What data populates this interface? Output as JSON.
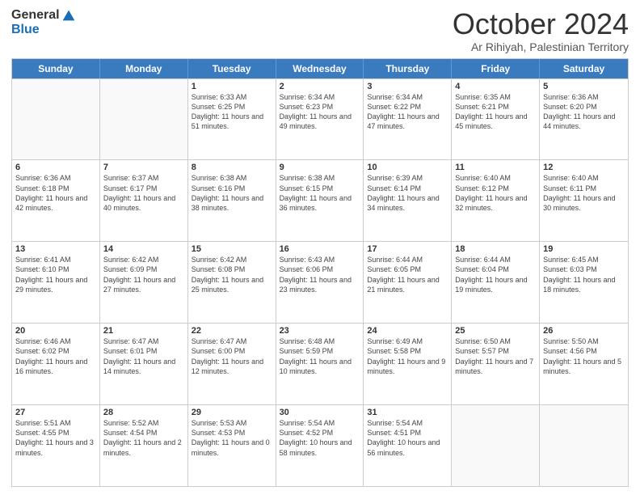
{
  "logo": {
    "general": "General",
    "blue": "Blue"
  },
  "title": "October 2024",
  "subtitle": "Ar Rihiyah, Palestinian Territory",
  "header_days": [
    "Sunday",
    "Monday",
    "Tuesday",
    "Wednesday",
    "Thursday",
    "Friday",
    "Saturday"
  ],
  "rows": [
    [
      {
        "day": "",
        "info": ""
      },
      {
        "day": "",
        "info": ""
      },
      {
        "day": "1",
        "info": "Sunrise: 6:33 AM\nSunset: 6:25 PM\nDaylight: 11 hours and 51 minutes."
      },
      {
        "day": "2",
        "info": "Sunrise: 6:34 AM\nSunset: 6:23 PM\nDaylight: 11 hours and 49 minutes."
      },
      {
        "day": "3",
        "info": "Sunrise: 6:34 AM\nSunset: 6:22 PM\nDaylight: 11 hours and 47 minutes."
      },
      {
        "day": "4",
        "info": "Sunrise: 6:35 AM\nSunset: 6:21 PM\nDaylight: 11 hours and 45 minutes."
      },
      {
        "day": "5",
        "info": "Sunrise: 6:36 AM\nSunset: 6:20 PM\nDaylight: 11 hours and 44 minutes."
      }
    ],
    [
      {
        "day": "6",
        "info": "Sunrise: 6:36 AM\nSunset: 6:18 PM\nDaylight: 11 hours and 42 minutes."
      },
      {
        "day": "7",
        "info": "Sunrise: 6:37 AM\nSunset: 6:17 PM\nDaylight: 11 hours and 40 minutes."
      },
      {
        "day": "8",
        "info": "Sunrise: 6:38 AM\nSunset: 6:16 PM\nDaylight: 11 hours and 38 minutes."
      },
      {
        "day": "9",
        "info": "Sunrise: 6:38 AM\nSunset: 6:15 PM\nDaylight: 11 hours and 36 minutes."
      },
      {
        "day": "10",
        "info": "Sunrise: 6:39 AM\nSunset: 6:14 PM\nDaylight: 11 hours and 34 minutes."
      },
      {
        "day": "11",
        "info": "Sunrise: 6:40 AM\nSunset: 6:12 PM\nDaylight: 11 hours and 32 minutes."
      },
      {
        "day": "12",
        "info": "Sunrise: 6:40 AM\nSunset: 6:11 PM\nDaylight: 11 hours and 30 minutes."
      }
    ],
    [
      {
        "day": "13",
        "info": "Sunrise: 6:41 AM\nSunset: 6:10 PM\nDaylight: 11 hours and 29 minutes."
      },
      {
        "day": "14",
        "info": "Sunrise: 6:42 AM\nSunset: 6:09 PM\nDaylight: 11 hours and 27 minutes."
      },
      {
        "day": "15",
        "info": "Sunrise: 6:42 AM\nSunset: 6:08 PM\nDaylight: 11 hours and 25 minutes."
      },
      {
        "day": "16",
        "info": "Sunrise: 6:43 AM\nSunset: 6:06 PM\nDaylight: 11 hours and 23 minutes."
      },
      {
        "day": "17",
        "info": "Sunrise: 6:44 AM\nSunset: 6:05 PM\nDaylight: 11 hours and 21 minutes."
      },
      {
        "day": "18",
        "info": "Sunrise: 6:44 AM\nSunset: 6:04 PM\nDaylight: 11 hours and 19 minutes."
      },
      {
        "day": "19",
        "info": "Sunrise: 6:45 AM\nSunset: 6:03 PM\nDaylight: 11 hours and 18 minutes."
      }
    ],
    [
      {
        "day": "20",
        "info": "Sunrise: 6:46 AM\nSunset: 6:02 PM\nDaylight: 11 hours and 16 minutes."
      },
      {
        "day": "21",
        "info": "Sunrise: 6:47 AM\nSunset: 6:01 PM\nDaylight: 11 hours and 14 minutes."
      },
      {
        "day": "22",
        "info": "Sunrise: 6:47 AM\nSunset: 6:00 PM\nDaylight: 11 hours and 12 minutes."
      },
      {
        "day": "23",
        "info": "Sunrise: 6:48 AM\nSunset: 5:59 PM\nDaylight: 11 hours and 10 minutes."
      },
      {
        "day": "24",
        "info": "Sunrise: 6:49 AM\nSunset: 5:58 PM\nDaylight: 11 hours and 9 minutes."
      },
      {
        "day": "25",
        "info": "Sunrise: 6:50 AM\nSunset: 5:57 PM\nDaylight: 11 hours and 7 minutes."
      },
      {
        "day": "26",
        "info": "Sunrise: 5:50 AM\nSunset: 4:56 PM\nDaylight: 11 hours and 5 minutes."
      }
    ],
    [
      {
        "day": "27",
        "info": "Sunrise: 5:51 AM\nSunset: 4:55 PM\nDaylight: 11 hours and 3 minutes."
      },
      {
        "day": "28",
        "info": "Sunrise: 5:52 AM\nSunset: 4:54 PM\nDaylight: 11 hours and 2 minutes."
      },
      {
        "day": "29",
        "info": "Sunrise: 5:53 AM\nSunset: 4:53 PM\nDaylight: 11 hours and 0 minutes."
      },
      {
        "day": "30",
        "info": "Sunrise: 5:54 AM\nSunset: 4:52 PM\nDaylight: 10 hours and 58 minutes."
      },
      {
        "day": "31",
        "info": "Sunrise: 5:54 AM\nSunset: 4:51 PM\nDaylight: 10 hours and 56 minutes."
      },
      {
        "day": "",
        "info": ""
      },
      {
        "day": "",
        "info": ""
      }
    ]
  ]
}
